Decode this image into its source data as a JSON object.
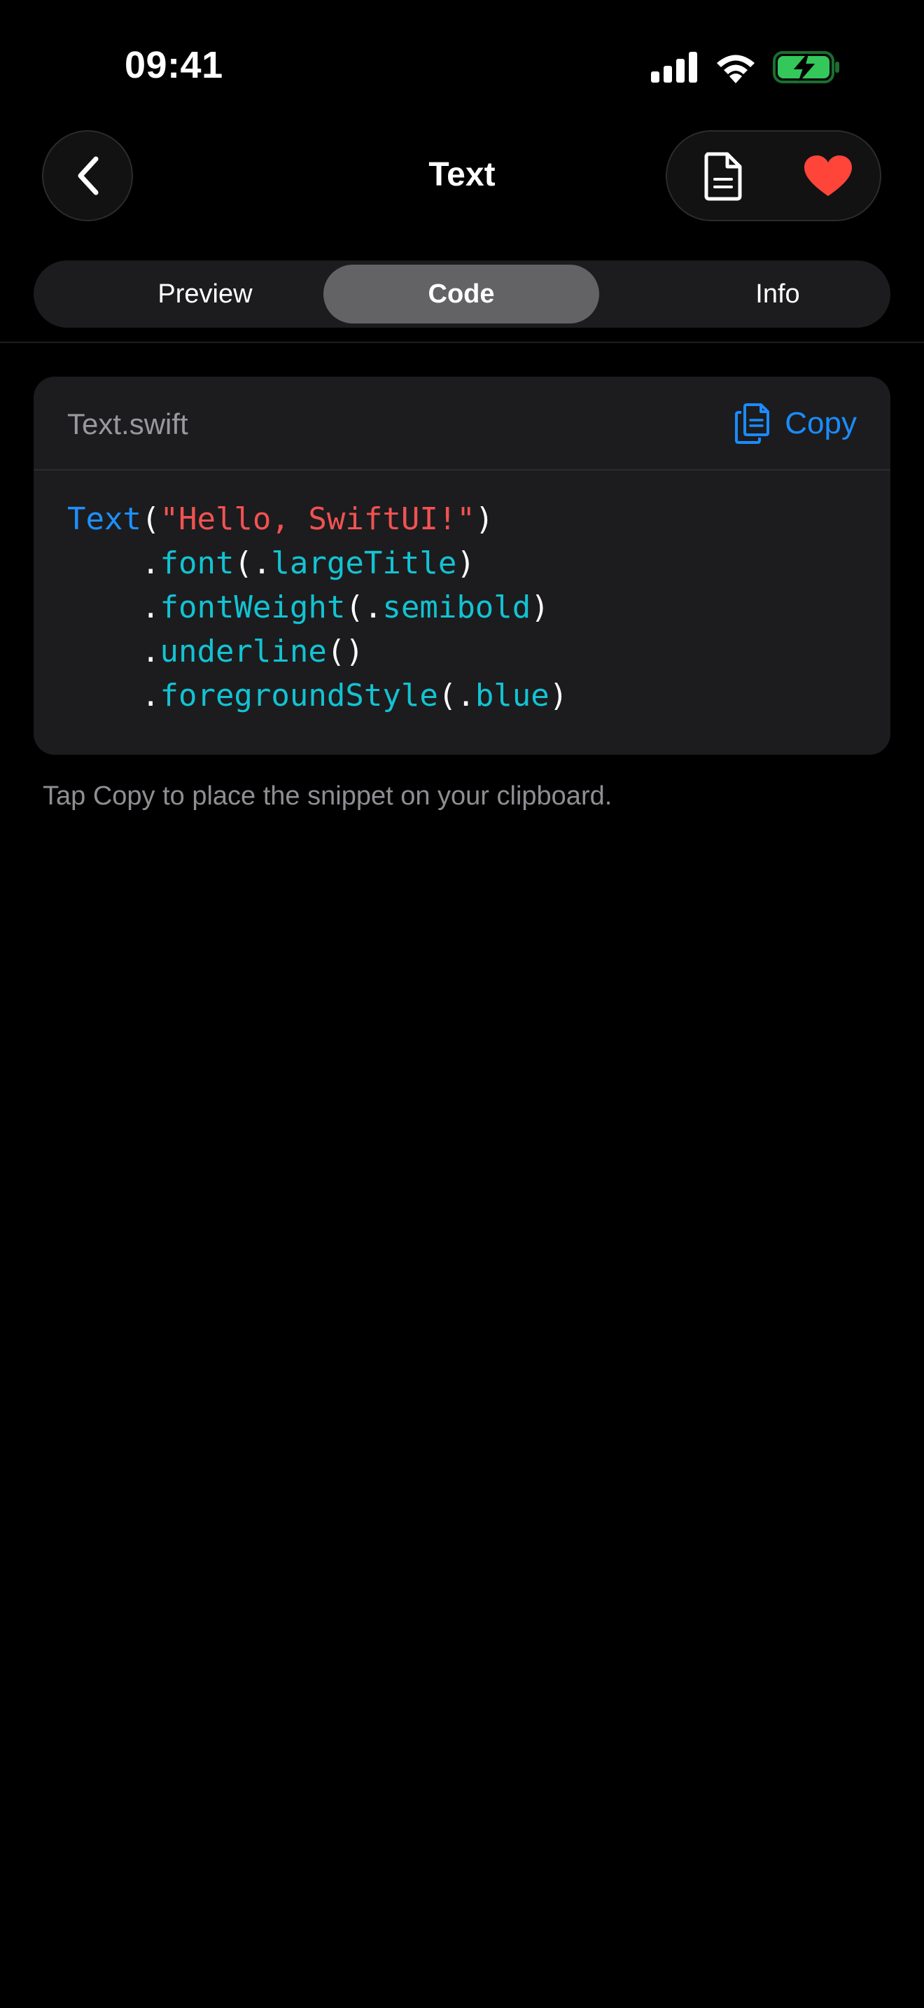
{
  "status_bar": {
    "time": "09:41"
  },
  "nav": {
    "title": "Text",
    "back_icon": "chevron-left-icon",
    "actions": [
      {
        "name": "document",
        "icon": "document-icon"
      },
      {
        "name": "favorite",
        "icon": "heart-icon",
        "state": "filled"
      }
    ]
  },
  "segments": {
    "items": [
      {
        "label": "Preview",
        "selected": false
      },
      {
        "label": "Code",
        "selected": true
      },
      {
        "label": "Info",
        "selected": false
      }
    ]
  },
  "code_card": {
    "file_name": "Text.swift",
    "copy_label": "Copy",
    "copy_icon": "copy-icon",
    "lines": [
      {
        "indent": "",
        "tokens": [
          {
            "text": "Text",
            "kind": "type"
          },
          {
            "text": "(",
            "kind": "punct"
          },
          {
            "text": "\"Hello, SwiftUI!\"",
            "kind": "string"
          },
          {
            "text": ")",
            "kind": "punct"
          }
        ]
      },
      {
        "indent": "    ",
        "tokens": [
          {
            "text": ".",
            "kind": "punct"
          },
          {
            "text": "font",
            "kind": "method"
          },
          {
            "text": "(.",
            "kind": "punct"
          },
          {
            "text": "largeTitle",
            "kind": "method"
          },
          {
            "text": ")",
            "kind": "punct"
          }
        ]
      },
      {
        "indent": "    ",
        "tokens": [
          {
            "text": ".",
            "kind": "punct"
          },
          {
            "text": "fontWeight",
            "kind": "method"
          },
          {
            "text": "(.",
            "kind": "punct"
          },
          {
            "text": "semibold",
            "kind": "method"
          },
          {
            "text": ")",
            "kind": "punct"
          }
        ]
      },
      {
        "indent": "    ",
        "tokens": [
          {
            "text": ".",
            "kind": "punct"
          },
          {
            "text": "underline",
            "kind": "method"
          },
          {
            "text": "()",
            "kind": "punct"
          }
        ]
      },
      {
        "indent": "    ",
        "tokens": [
          {
            "text": ".",
            "kind": "punct"
          },
          {
            "text": "foregroundStyle",
            "kind": "method"
          },
          {
            "text": "(.",
            "kind": "punct"
          },
          {
            "text": "blue",
            "kind": "method"
          },
          {
            "text": ")",
            "kind": "punct"
          }
        ]
      }
    ]
  },
  "hint": "Tap Copy to place the snippet on your clipboard.",
  "colors": {
    "background": "#000000",
    "surface": "#1c1c1e",
    "accent": "#1a8cff",
    "heart": "#ff453a",
    "battery": "#34c759",
    "syntax_type": "#1e90ff",
    "syntax_string": "#f25252",
    "syntax_method": "#12c3d3"
  }
}
